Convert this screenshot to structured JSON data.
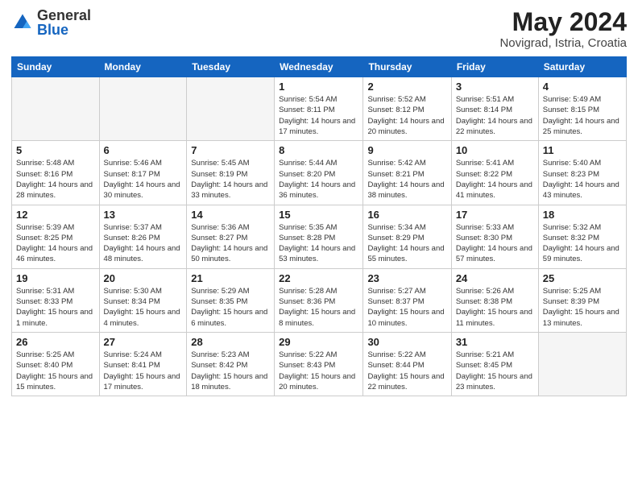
{
  "logo": {
    "general": "General",
    "blue": "Blue"
  },
  "header": {
    "month_year": "May 2024",
    "location": "Novigrad, Istria, Croatia"
  },
  "weekdays": [
    "Sunday",
    "Monday",
    "Tuesday",
    "Wednesday",
    "Thursday",
    "Friday",
    "Saturday"
  ],
  "weeks": [
    [
      {
        "day": "",
        "info": ""
      },
      {
        "day": "",
        "info": ""
      },
      {
        "day": "",
        "info": ""
      },
      {
        "day": "1",
        "info": "Sunrise: 5:54 AM\nSunset: 8:11 PM\nDaylight: 14 hours and 17 minutes."
      },
      {
        "day": "2",
        "info": "Sunrise: 5:52 AM\nSunset: 8:12 PM\nDaylight: 14 hours and 20 minutes."
      },
      {
        "day": "3",
        "info": "Sunrise: 5:51 AM\nSunset: 8:14 PM\nDaylight: 14 hours and 22 minutes."
      },
      {
        "day": "4",
        "info": "Sunrise: 5:49 AM\nSunset: 8:15 PM\nDaylight: 14 hours and 25 minutes."
      }
    ],
    [
      {
        "day": "5",
        "info": "Sunrise: 5:48 AM\nSunset: 8:16 PM\nDaylight: 14 hours and 28 minutes."
      },
      {
        "day": "6",
        "info": "Sunrise: 5:46 AM\nSunset: 8:17 PM\nDaylight: 14 hours and 30 minutes."
      },
      {
        "day": "7",
        "info": "Sunrise: 5:45 AM\nSunset: 8:19 PM\nDaylight: 14 hours and 33 minutes."
      },
      {
        "day": "8",
        "info": "Sunrise: 5:44 AM\nSunset: 8:20 PM\nDaylight: 14 hours and 36 minutes."
      },
      {
        "day": "9",
        "info": "Sunrise: 5:42 AM\nSunset: 8:21 PM\nDaylight: 14 hours and 38 minutes."
      },
      {
        "day": "10",
        "info": "Sunrise: 5:41 AM\nSunset: 8:22 PM\nDaylight: 14 hours and 41 minutes."
      },
      {
        "day": "11",
        "info": "Sunrise: 5:40 AM\nSunset: 8:23 PM\nDaylight: 14 hours and 43 minutes."
      }
    ],
    [
      {
        "day": "12",
        "info": "Sunrise: 5:39 AM\nSunset: 8:25 PM\nDaylight: 14 hours and 46 minutes."
      },
      {
        "day": "13",
        "info": "Sunrise: 5:37 AM\nSunset: 8:26 PM\nDaylight: 14 hours and 48 minutes."
      },
      {
        "day": "14",
        "info": "Sunrise: 5:36 AM\nSunset: 8:27 PM\nDaylight: 14 hours and 50 minutes."
      },
      {
        "day": "15",
        "info": "Sunrise: 5:35 AM\nSunset: 8:28 PM\nDaylight: 14 hours and 53 minutes."
      },
      {
        "day": "16",
        "info": "Sunrise: 5:34 AM\nSunset: 8:29 PM\nDaylight: 14 hours and 55 minutes."
      },
      {
        "day": "17",
        "info": "Sunrise: 5:33 AM\nSunset: 8:30 PM\nDaylight: 14 hours and 57 minutes."
      },
      {
        "day": "18",
        "info": "Sunrise: 5:32 AM\nSunset: 8:32 PM\nDaylight: 14 hours and 59 minutes."
      }
    ],
    [
      {
        "day": "19",
        "info": "Sunrise: 5:31 AM\nSunset: 8:33 PM\nDaylight: 15 hours and 1 minute."
      },
      {
        "day": "20",
        "info": "Sunrise: 5:30 AM\nSunset: 8:34 PM\nDaylight: 15 hours and 4 minutes."
      },
      {
        "day": "21",
        "info": "Sunrise: 5:29 AM\nSunset: 8:35 PM\nDaylight: 15 hours and 6 minutes."
      },
      {
        "day": "22",
        "info": "Sunrise: 5:28 AM\nSunset: 8:36 PM\nDaylight: 15 hours and 8 minutes."
      },
      {
        "day": "23",
        "info": "Sunrise: 5:27 AM\nSunset: 8:37 PM\nDaylight: 15 hours and 10 minutes."
      },
      {
        "day": "24",
        "info": "Sunrise: 5:26 AM\nSunset: 8:38 PM\nDaylight: 15 hours and 11 minutes."
      },
      {
        "day": "25",
        "info": "Sunrise: 5:25 AM\nSunset: 8:39 PM\nDaylight: 15 hours and 13 minutes."
      }
    ],
    [
      {
        "day": "26",
        "info": "Sunrise: 5:25 AM\nSunset: 8:40 PM\nDaylight: 15 hours and 15 minutes."
      },
      {
        "day": "27",
        "info": "Sunrise: 5:24 AM\nSunset: 8:41 PM\nDaylight: 15 hours and 17 minutes."
      },
      {
        "day": "28",
        "info": "Sunrise: 5:23 AM\nSunset: 8:42 PM\nDaylight: 15 hours and 18 minutes."
      },
      {
        "day": "29",
        "info": "Sunrise: 5:22 AM\nSunset: 8:43 PM\nDaylight: 15 hours and 20 minutes."
      },
      {
        "day": "30",
        "info": "Sunrise: 5:22 AM\nSunset: 8:44 PM\nDaylight: 15 hours and 22 minutes."
      },
      {
        "day": "31",
        "info": "Sunrise: 5:21 AM\nSunset: 8:45 PM\nDaylight: 15 hours and 23 minutes."
      },
      {
        "day": "",
        "info": ""
      }
    ]
  ]
}
